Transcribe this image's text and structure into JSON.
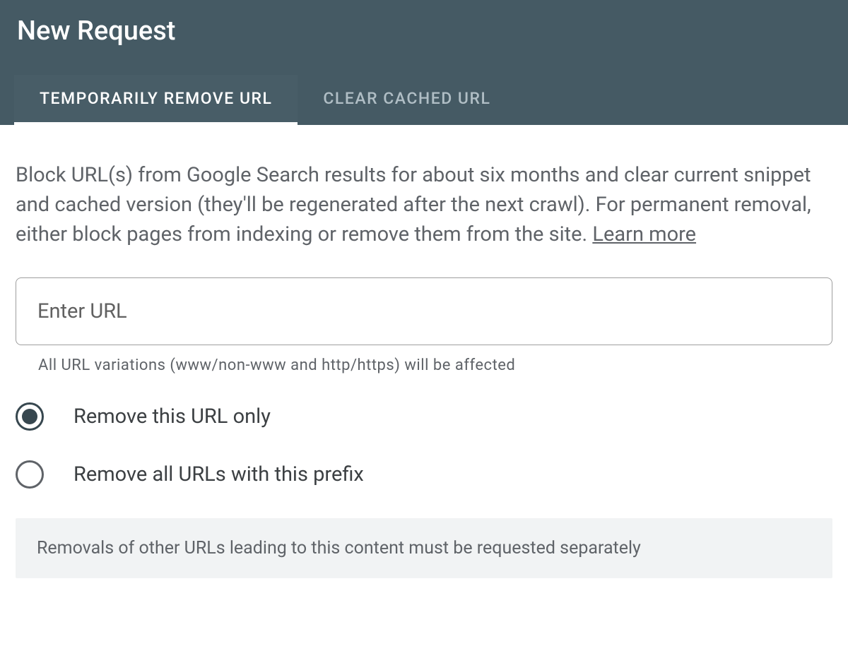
{
  "header": {
    "title": "New Request"
  },
  "tabs": [
    {
      "label": "TEMPORARILY REMOVE URL",
      "active": true
    },
    {
      "label": "CLEAR CACHED URL",
      "active": false
    }
  ],
  "main": {
    "description": "Block URL(s) from Google Search results for about six months and clear current snippet and cached version (they'll be regenerated after the next crawl). For permanent removal, either block pages from indexing or remove them from the site. ",
    "learn_more": "Learn more",
    "url_input": {
      "placeholder": "Enter URL",
      "value": ""
    },
    "helper_text": "All URL variations (www/non-www and http/https) will be affected",
    "radio_options": [
      {
        "label": "Remove this URL only",
        "selected": true
      },
      {
        "label": "Remove all URLs with this prefix",
        "selected": false
      }
    ],
    "info_box": "Removals of other URLs leading to this content must be requested separately"
  }
}
